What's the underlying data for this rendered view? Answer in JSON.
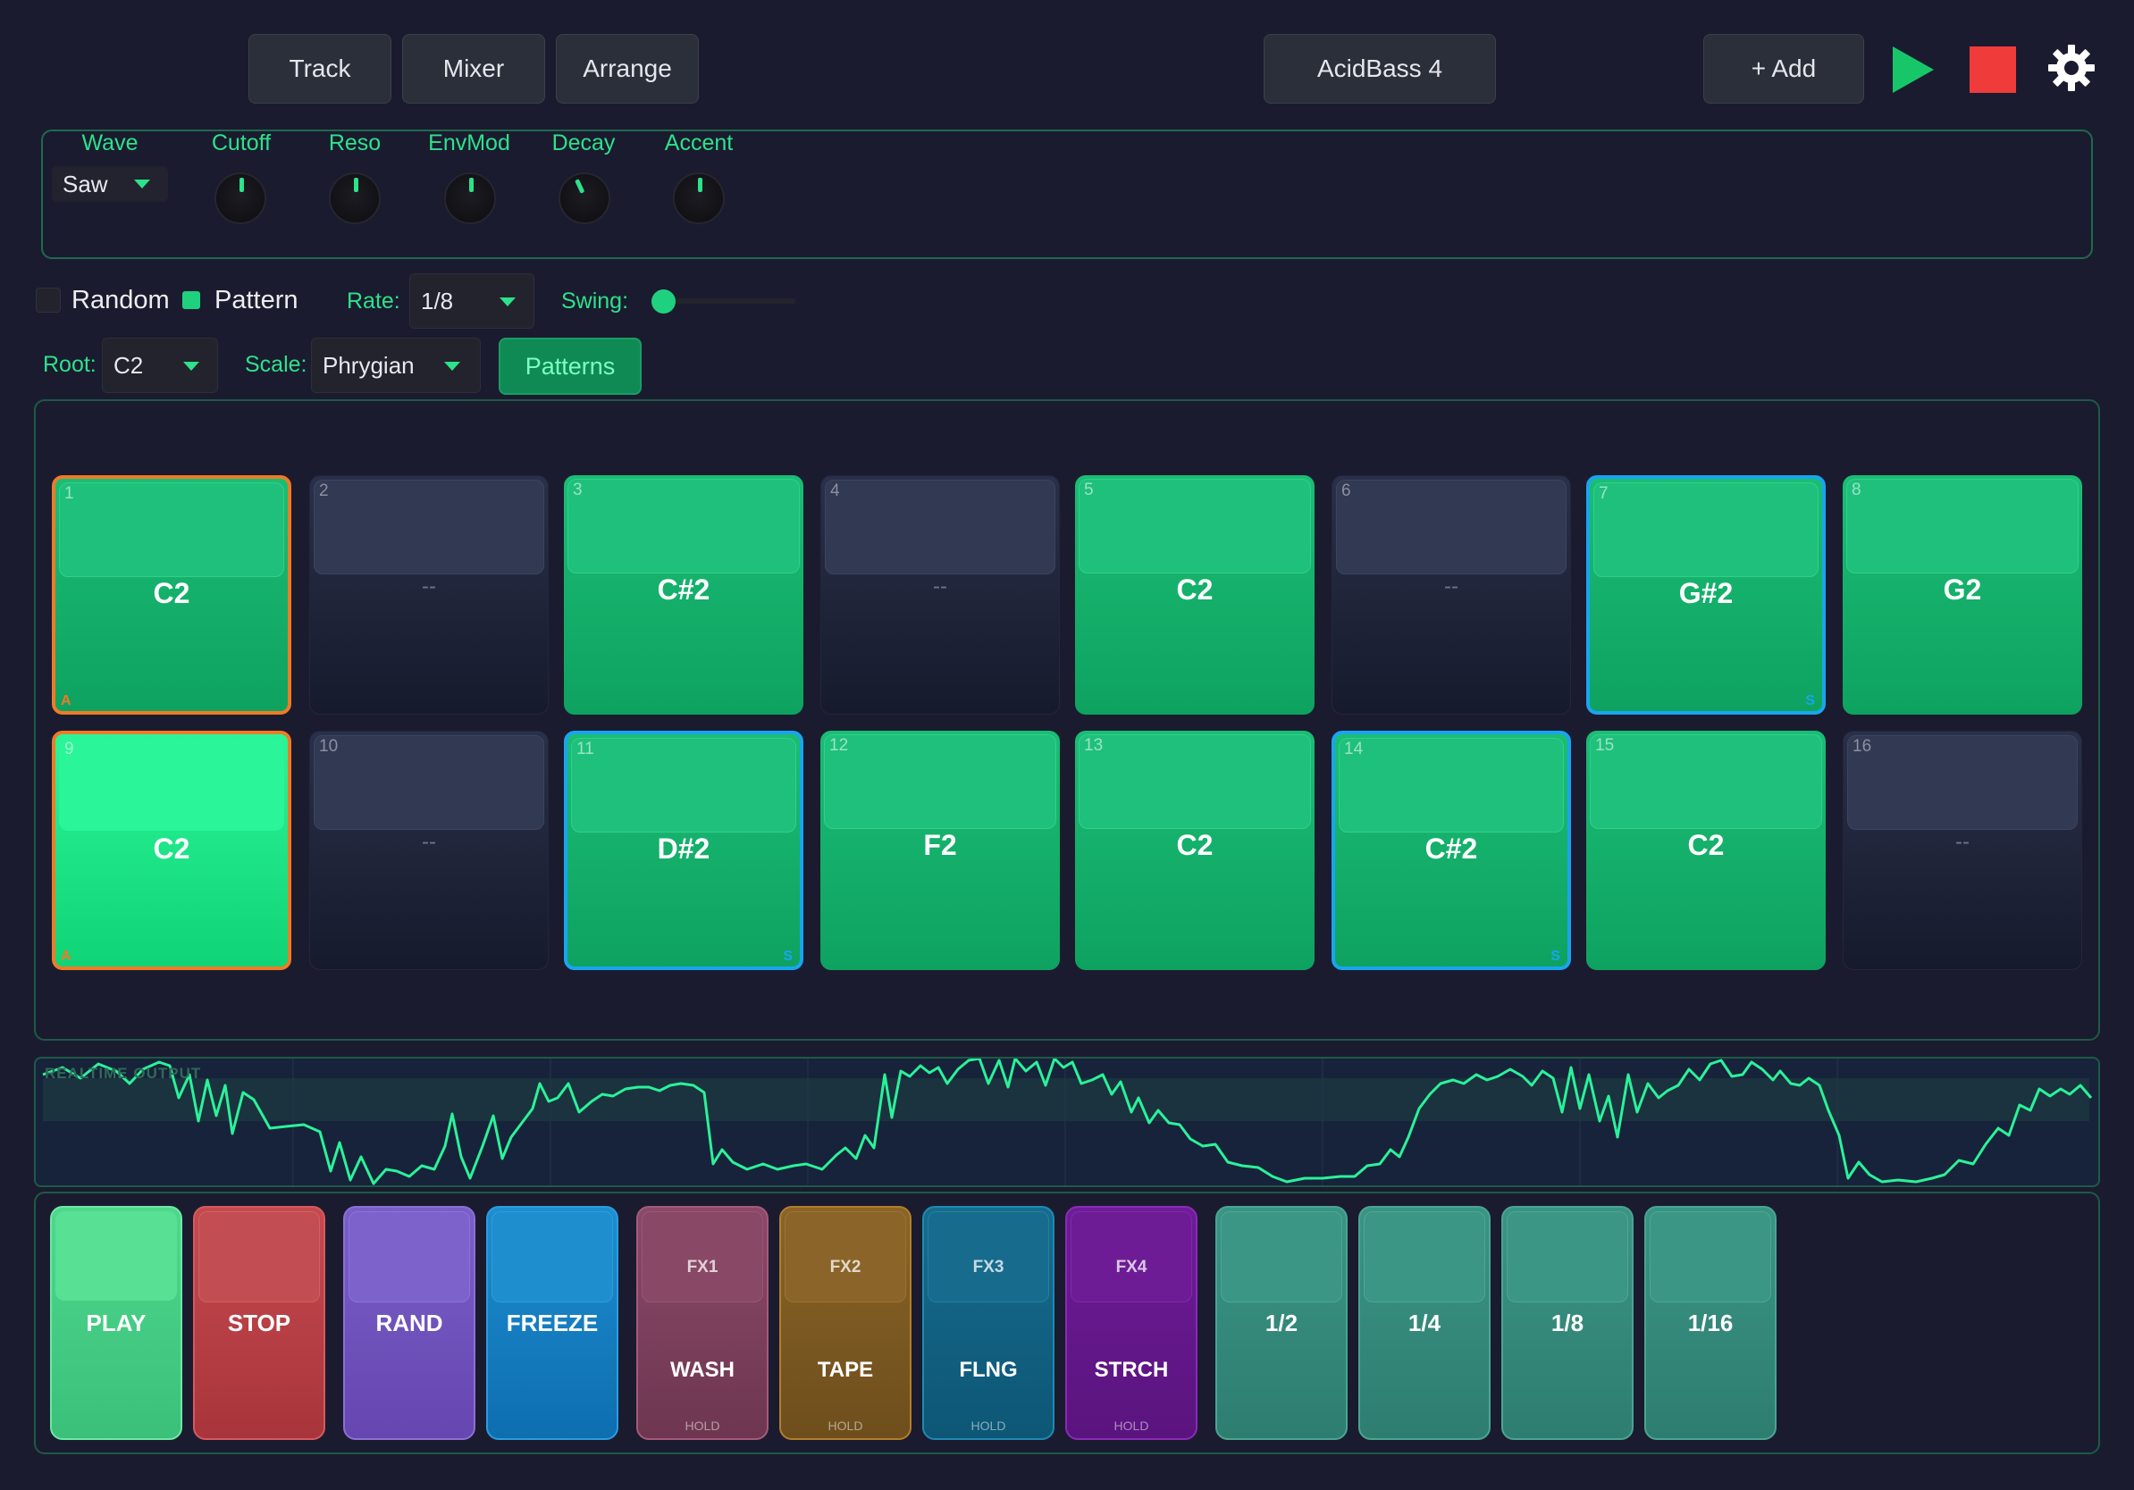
{
  "tabs": [
    {
      "label": "Track"
    },
    {
      "label": "Mixer"
    },
    {
      "label": "Arrange"
    }
  ],
  "track_name": "AcidBass 4",
  "add_label": "+ Add",
  "synth": {
    "wave": {
      "label": "Wave",
      "value": "Saw"
    },
    "knobs": [
      {
        "label": "Cutoff"
      },
      {
        "label": "Reso"
      },
      {
        "label": "EnvMod"
      },
      {
        "label": "Decay"
      },
      {
        "label": "Accent"
      }
    ]
  },
  "controls": {
    "random_label": "Random",
    "pattern_label": "Pattern",
    "rate_label": "Rate:",
    "rate_value": "1/8",
    "swing_label": "Swing:",
    "root_label": "Root:",
    "root_value": "C2",
    "scale_label": "Scale:",
    "scale_value": "Phrygian",
    "patterns_button": "Patterns"
  },
  "steps": [
    {
      "num": "1",
      "note": "C2",
      "flag": "A"
    },
    {
      "num": "2",
      "note": "--"
    },
    {
      "num": "3",
      "note": "C#2"
    },
    {
      "num": "4",
      "note": "--"
    },
    {
      "num": "5",
      "note": "C2"
    },
    {
      "num": "6",
      "note": "--"
    },
    {
      "num": "7",
      "note": "G#2",
      "flagS": "S"
    },
    {
      "num": "8",
      "note": "G2"
    },
    {
      "num": "9",
      "note": "C2",
      "flag": "A"
    },
    {
      "num": "10",
      "note": "--"
    },
    {
      "num": "11",
      "note": "D#2",
      "flagS": "S"
    },
    {
      "num": "12",
      "note": "F2"
    },
    {
      "num": "13",
      "note": "C2"
    },
    {
      "num": "14",
      "note": "C#2",
      "flagS": "S"
    },
    {
      "num": "15",
      "note": "C2"
    },
    {
      "num": "16",
      "note": "--"
    }
  ],
  "scope_label": "REALTIME OUTPUT",
  "pads": {
    "play": "PLAY",
    "stop": "STOP",
    "rand": "RAND",
    "freeze": "FREEZE",
    "fx": [
      {
        "id": "FX1",
        "name": "WASH",
        "hold": "HOLD"
      },
      {
        "id": "FX2",
        "name": "TAPE",
        "hold": "HOLD"
      },
      {
        "id": "FX3",
        "name": "FLNG",
        "hold": "HOLD"
      },
      {
        "id": "FX4",
        "name": "STRCH",
        "hold": "HOLD"
      }
    ],
    "divs": [
      {
        "label": "1/2"
      },
      {
        "label": "1/4"
      },
      {
        "label": "1/8"
      },
      {
        "label": "1/16"
      }
    ]
  }
}
